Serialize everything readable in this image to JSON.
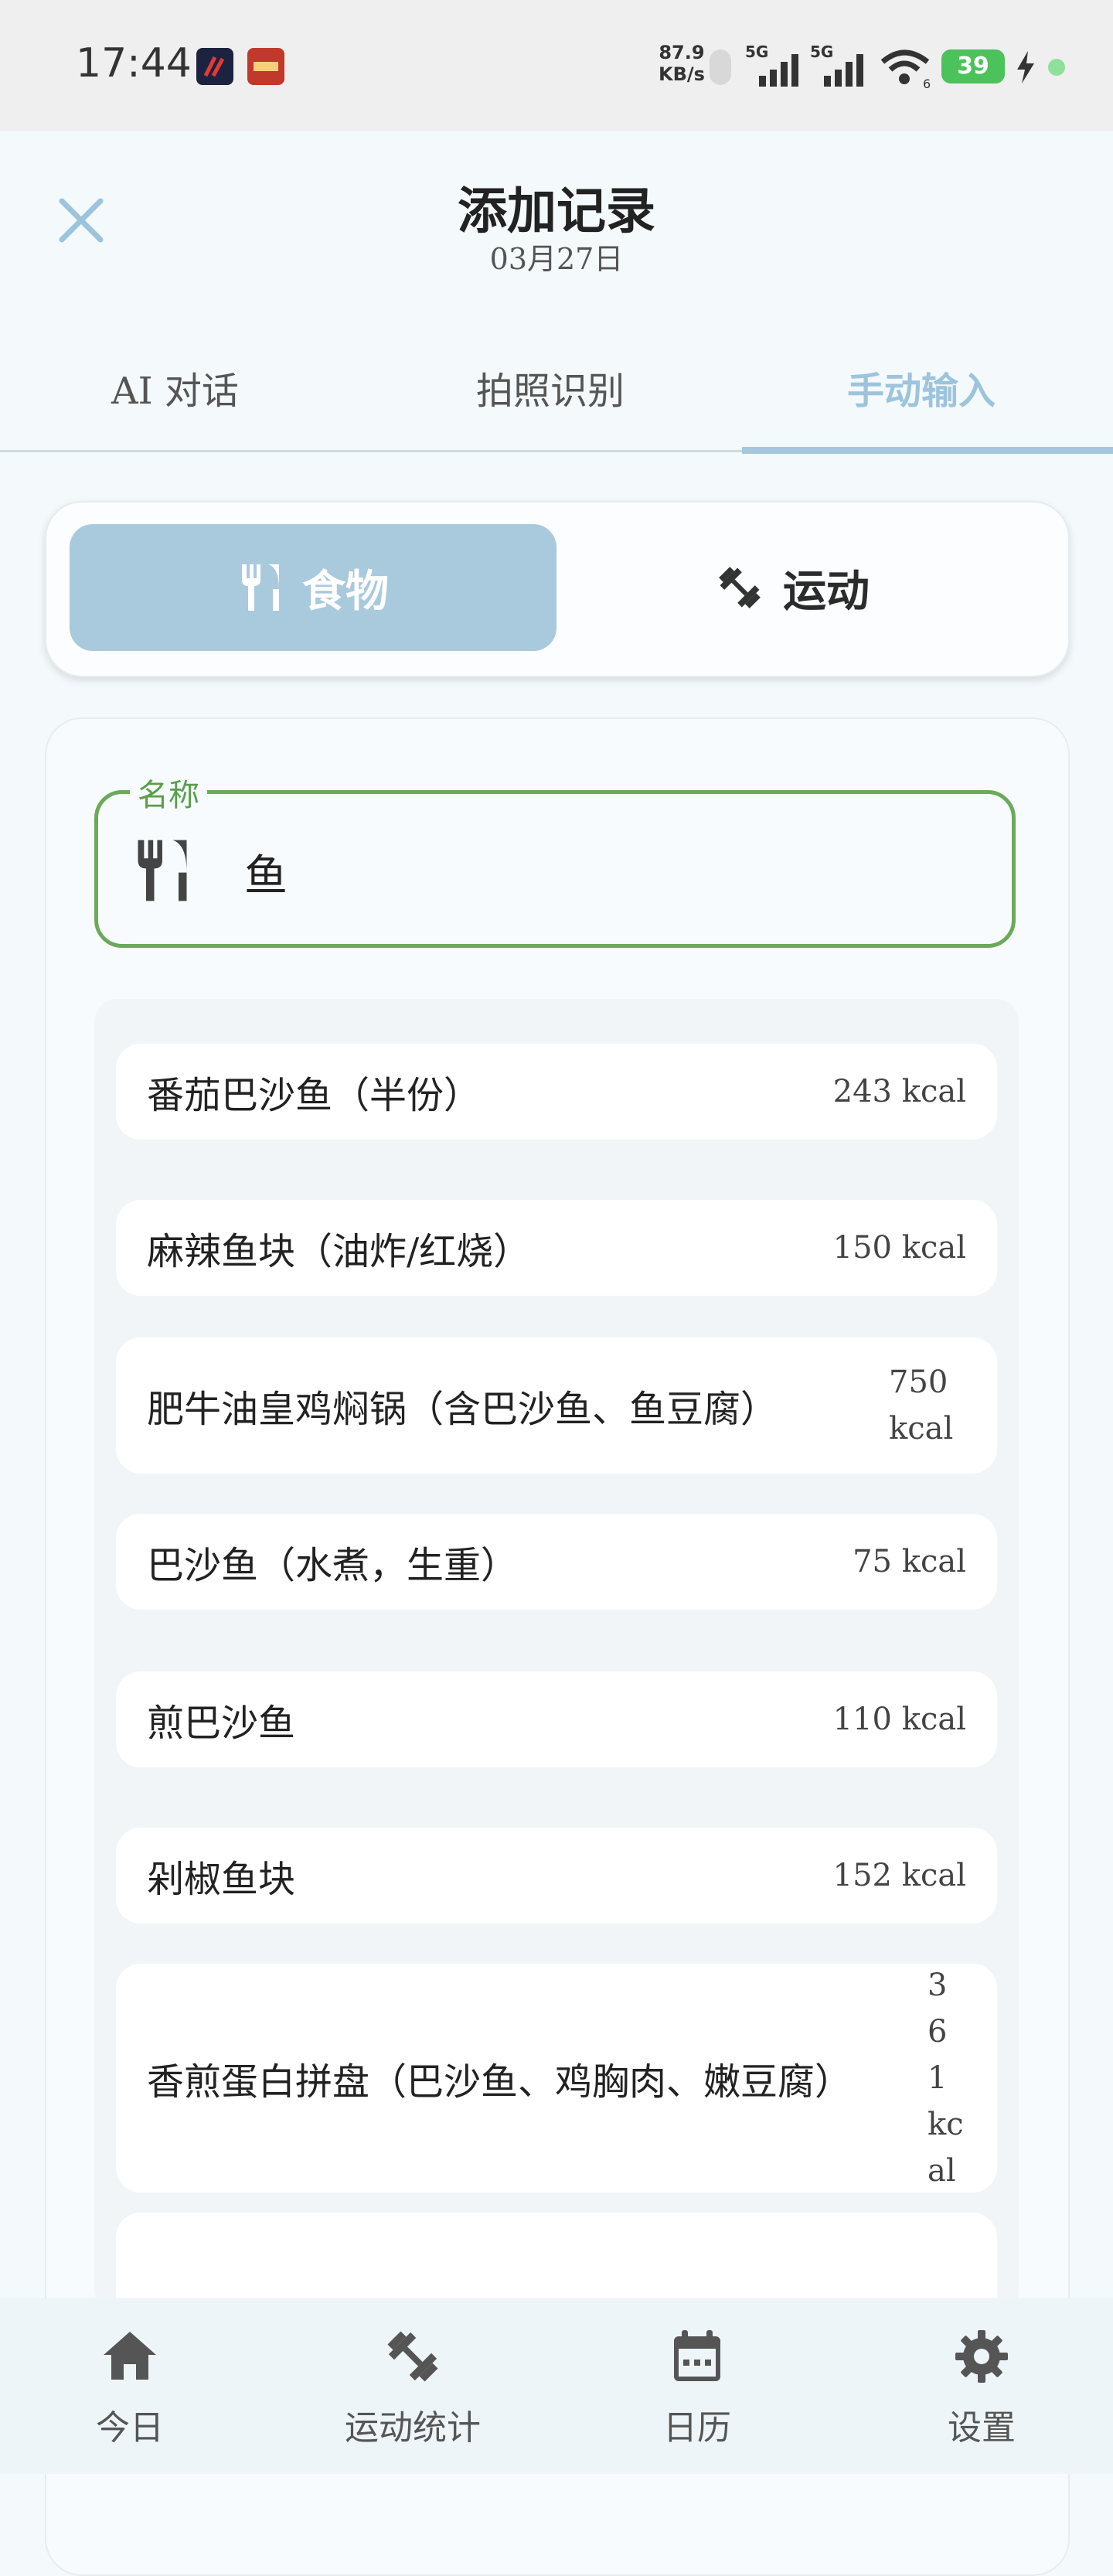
{
  "status_bar": {
    "time": "17:44",
    "net_speed_value": "87.9",
    "net_speed_unit": "KB/s",
    "signal1_label": "5G",
    "signal2_label": "5G",
    "wifi_sub": "6",
    "battery": "39"
  },
  "header": {
    "title": "添加记录",
    "date": "03月27日"
  },
  "tabs": [
    {
      "label": "AI  对话"
    },
    {
      "label": "拍照识别"
    },
    {
      "label": "手动输入"
    }
  ],
  "type_selector": {
    "food_label": "食物",
    "sport_label": "运动"
  },
  "form": {
    "name_label": "名称",
    "name_value": "鱼"
  },
  "results": [
    {
      "name": "番茄巴沙鱼（半份）",
      "kcal": "243  kcal"
    },
    {
      "name": "麻辣鱼块（油炸/红烧）",
      "kcal": "150  kcal"
    },
    {
      "name": "肥牛油皇鸡焖锅（含巴沙鱼、鱼豆腐）",
      "kcal": "750 kcal"
    },
    {
      "name": "巴沙鱼（水煮，生重）",
      "kcal": "75  kcal"
    },
    {
      "name": "煎巴沙鱼",
      "kcal": "110  kcal"
    },
    {
      "name": "剁椒鱼块",
      "kcal": "152  kcal"
    },
    {
      "name": "香煎蛋白拼盘（巴沙鱼、鸡胸肉、嫩豆腐）",
      "kcal": "361 kcal"
    }
  ],
  "bottom_nav": [
    {
      "label": "今日",
      "icon": "home-icon"
    },
    {
      "label": "运动统计",
      "icon": "dumbbell-icon"
    },
    {
      "label": "日历",
      "icon": "calendar-icon"
    },
    {
      "label": "设置",
      "icon": "gear-icon"
    }
  ],
  "colors": {
    "accent": "#a9c9dd",
    "field_border": "#6aaa5a",
    "battery": "#4cc25b"
  }
}
